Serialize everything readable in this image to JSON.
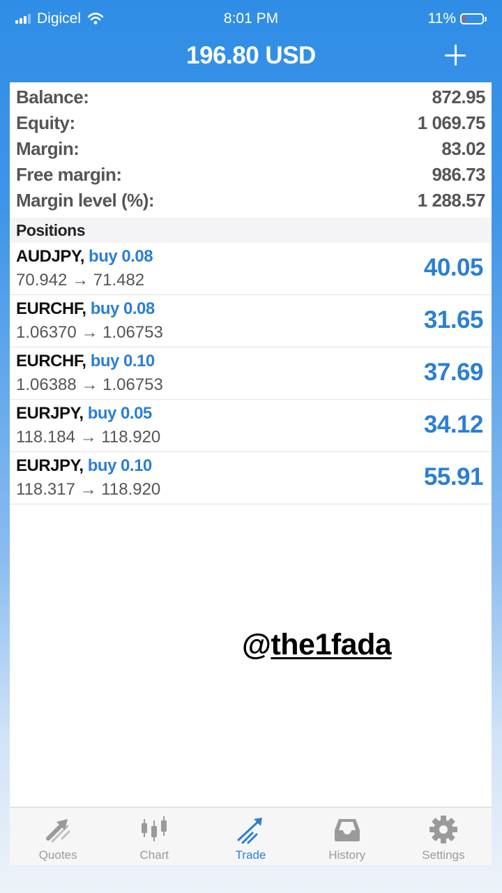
{
  "status_bar": {
    "carrier": "Digicel",
    "time": "8:01 PM",
    "battery": "11%",
    "battery_level": 0.11
  },
  "header": {
    "title": "196.80 USD",
    "add_icon": "plus-icon"
  },
  "account": [
    {
      "label": "Balance:",
      "value": "872.95"
    },
    {
      "label": "Equity:",
      "value": "1 069.75"
    },
    {
      "label": "Margin:",
      "value": "83.02"
    },
    {
      "label": "Free margin:",
      "value": "986.73"
    },
    {
      "label": "Margin level (%):",
      "value": "1 288.57"
    }
  ],
  "positions_header": "Positions",
  "positions": [
    {
      "symbol": "AUDJPY,",
      "direction": "buy 0.08",
      "prices": "70.942 → 71.482",
      "profit": "40.05"
    },
    {
      "symbol": "EURCHF,",
      "direction": "buy 0.08",
      "prices": "1.06370 → 1.06753",
      "profit": "31.65"
    },
    {
      "symbol": "EURCHF,",
      "direction": "buy 0.10",
      "prices": "1.06388 → 1.06753",
      "profit": "37.69"
    },
    {
      "symbol": "EURJPY,",
      "direction": "buy 0.05",
      "prices": "118.184 → 118.920",
      "profit": "34.12"
    },
    {
      "symbol": "EURJPY,",
      "direction": "buy 0.10",
      "prices": "118.317 → 118.920",
      "profit": "55.91"
    }
  ],
  "watermark": {
    "at": "@",
    "handle": "the1fada"
  },
  "tabs": [
    {
      "label": "Quotes",
      "icon": "quotes-icon",
      "active": false
    },
    {
      "label": "Chart",
      "icon": "candlestick-chart-icon",
      "active": false
    },
    {
      "label": "Trade",
      "icon": "trade-trend-icon",
      "active": true
    },
    {
      "label": "History",
      "icon": "history-tray-icon",
      "active": false
    },
    {
      "label": "Settings",
      "icon": "settings-gear-icon",
      "active": false
    }
  ],
  "colors": {
    "accent": "#2b7fd4",
    "header_background": "#2f8de6"
  }
}
